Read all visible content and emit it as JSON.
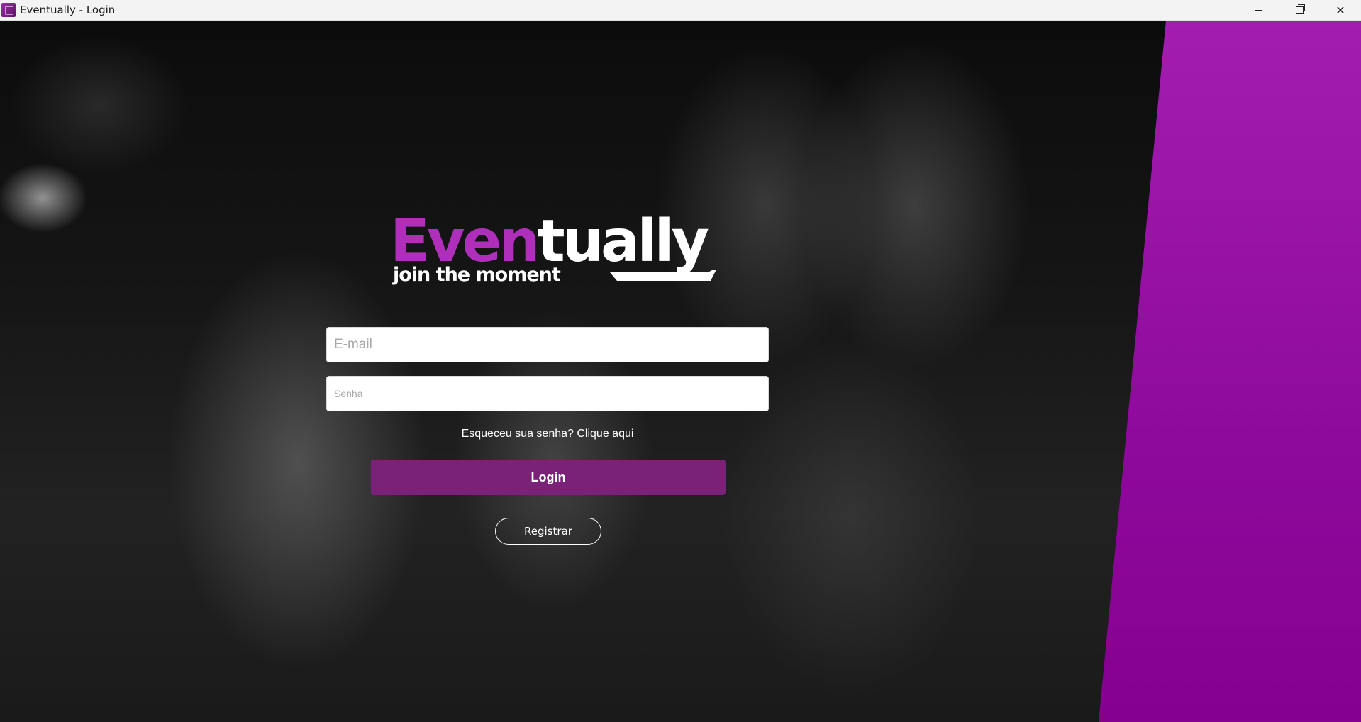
{
  "window": {
    "title": "Eventually - Login",
    "controls": {
      "minimize": "minimize",
      "restore": "restore",
      "close": "✕"
    }
  },
  "logo": {
    "word_part1": "Even",
    "word_part2": "tually",
    "tagline": "join the moment"
  },
  "form": {
    "email": {
      "placeholder": "E-mail",
      "value": ""
    },
    "password": {
      "placeholder": "Senha",
      "value": ""
    },
    "forgot_text": "Esqueceu sua senha? Clique aqui",
    "login_label": "Login",
    "register_label": "Registrar"
  },
  "colors": {
    "accent_purple": "#b02fba",
    "login_button": "#7a2278",
    "side_band": "#8e0a9c",
    "titlebar": "#f3f3f3"
  },
  "icons": {
    "app": "eventually-app-icon",
    "minimize": "minimize-icon",
    "restore": "restore-icon",
    "close": "close-icon"
  }
}
